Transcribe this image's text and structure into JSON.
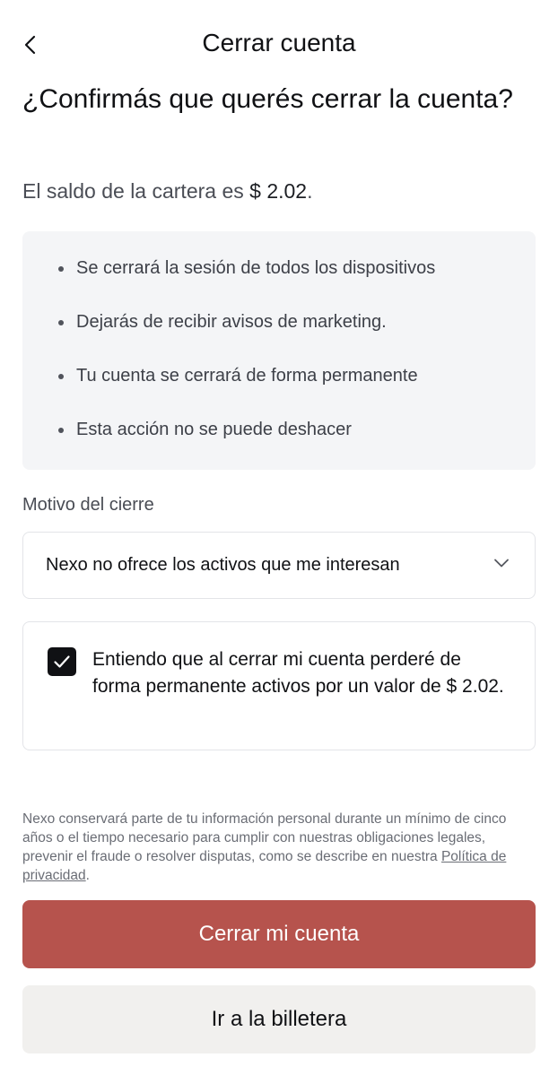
{
  "header": {
    "title": "Cerrar cuenta",
    "back_icon": "chevron-left-icon"
  },
  "question": "¿Confirmás que querés cerrar la cuenta?",
  "balance": {
    "prefix": "El saldo de la cartera es ",
    "amount": "$ 2.02",
    "suffix": "."
  },
  "info_bullets": [
    "Se cerrará la sesión de todos los dispositivos",
    "Dejarás de recibir avisos de marketing.",
    "Tu cuenta se cerrará de forma permanente",
    "Esta acción no se puede deshacer"
  ],
  "reason": {
    "label": "Motivo del cierre",
    "selected": "Nexo no ofrece los activos que me interesan",
    "chevron_icon": "chevron-down-icon"
  },
  "consent": {
    "checked": true,
    "text": "Entiendo que al cerrar mi cuenta perderé de forma permanente activos por un valor de $ 2.02."
  },
  "legal": {
    "text": "Nexo conservará parte de tu información personal durante un mínimo de cinco años o el tiempo necesario para cumplir con nuestras obligaciones legales, prevenir el fraude o resolver disputas, como se describe en nuestra ",
    "link": "Política de privacidad",
    "suffix": "."
  },
  "buttons": {
    "close_account": "Cerrar mi cuenta",
    "go_wallet": "Ir a la billetera"
  },
  "colors": {
    "primary": "#b6534d",
    "secondary_bg": "#f1f0ee",
    "info_bg": "#f4f5f7",
    "text": "#101114"
  }
}
